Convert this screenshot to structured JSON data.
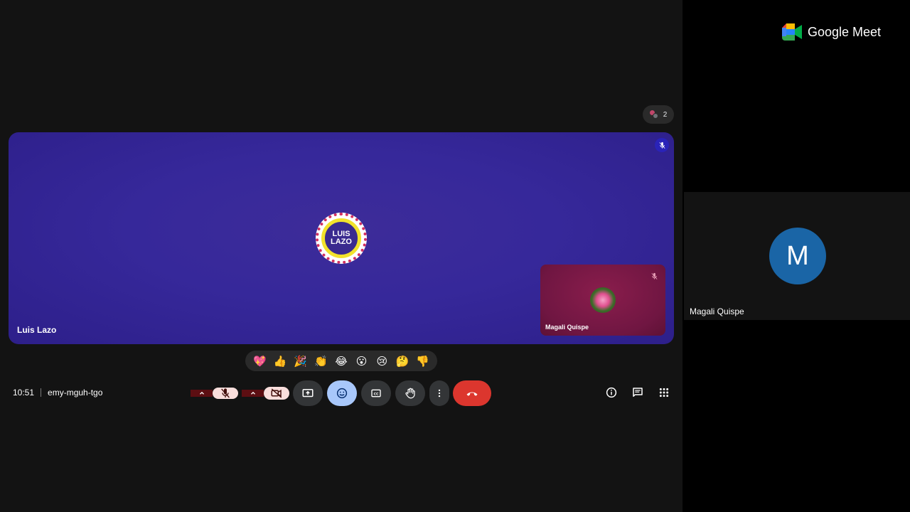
{
  "brand": {
    "name": "Google Meet"
  },
  "counter": {
    "count": "2"
  },
  "main_tile": {
    "name": "Luis Lazo",
    "logo_line1": "LUIS",
    "logo_line2": "LAZO"
  },
  "self_tile": {
    "name": "Magali Quispe"
  },
  "reactions": [
    "💖",
    "👍",
    "🎉",
    "👏",
    "😂",
    "😮",
    "😢",
    "🤔",
    "👎"
  ],
  "meeting": {
    "time": "10:51",
    "code": "emy-mguh-tgo"
  },
  "side_tile": {
    "initial": "M",
    "name": "Magali Quispe"
  },
  "colors": {
    "main_bg": "#36289a",
    "end_call": "#dc362e",
    "avatar": "#1a65a6",
    "emoji_active": "#a8c7fa"
  },
  "icons": {
    "mic": "mic-off-icon",
    "cam": "camera-off-icon",
    "present": "present-icon",
    "emoji": "emoji-icon",
    "captions": "captions-icon",
    "hand": "hand-icon",
    "more": "more-vert-icon",
    "end": "call-end-icon",
    "info": "info-icon",
    "chat": "chat-icon",
    "activities": "apps-grid-icon"
  }
}
